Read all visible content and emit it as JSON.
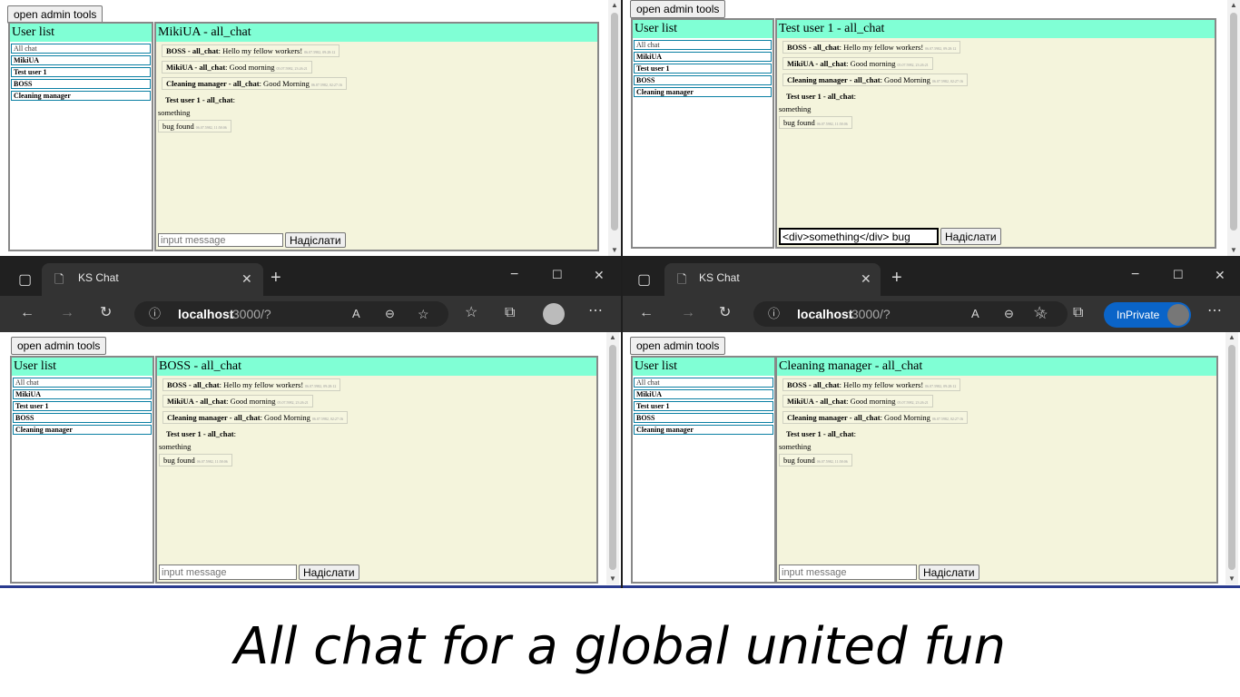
{
  "admin_button": "open admin tools",
  "userlist_title": "User list",
  "users": [
    "All chat",
    "MikiUA",
    "Test user 1",
    "BOSS",
    "Cleaning manager"
  ],
  "send_label": "Надіслати",
  "input_placeholder": "input message",
  "messages": [
    {
      "sender": "BOSS - all_chat",
      "text": ": Hello my fellow workers!",
      "time": "06.07.5982, 09:28:12"
    },
    {
      "sender": "MikiUA - all_chat",
      "text": ": Good morning",
      "time": "05.07.5982, 23:26:21"
    },
    {
      "sender": "Cleaning manager - all_chat",
      "text": ": Good Morning",
      "time": "06.07.5982, 02:27:16"
    },
    {
      "sender": "Test user 1 - all_chat",
      "text": ":",
      "time": ""
    }
  ],
  "plain_text": "something",
  "bug_msg": {
    "text": "bug found",
    "time": "06.07.5982, 11:58:06"
  },
  "panes": {
    "tl": {
      "header": "MikiUA - all_chat"
    },
    "tr": {
      "header": "Test user 1 - all_chat",
      "input_value": "<div>something</div> bug"
    },
    "bl": {
      "header": "BOSS - all_chat"
    },
    "br": {
      "header": "Cleaning manager - all_chat"
    }
  },
  "browser": {
    "tab_title": "KS Chat",
    "url_host": "localhost",
    "url_rest": ":3000/?",
    "inprivate_label": "InPrivate"
  },
  "caption": "All chat for a global united fun"
}
